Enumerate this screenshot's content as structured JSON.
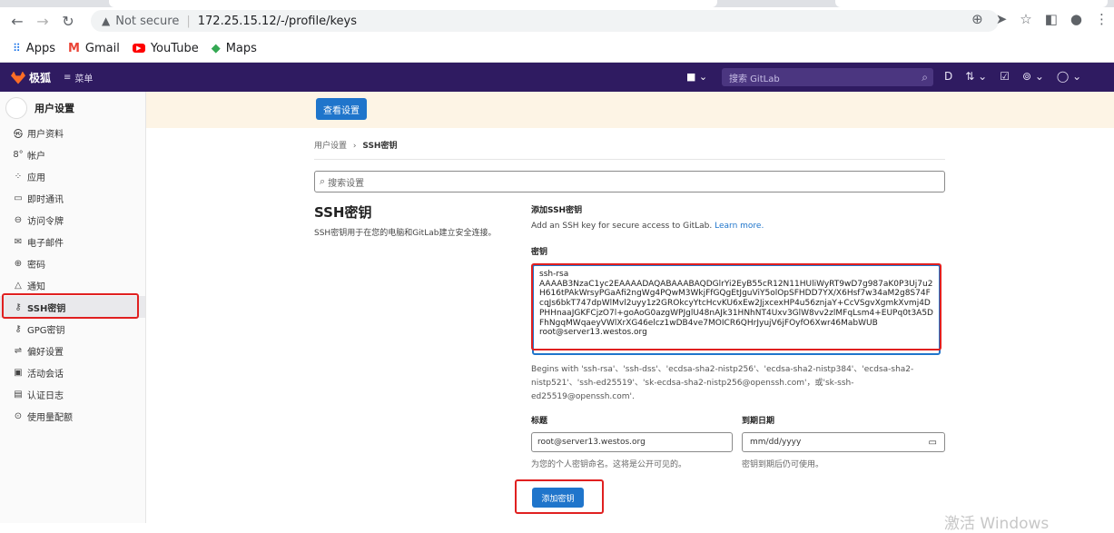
{
  "browser": {
    "warning_text": "Not secure",
    "url": "172.25.15.12/-/profile/keys",
    "bookmarks": [
      {
        "label": "Apps",
        "icon": "apps-grid-icon"
      },
      {
        "label": "Gmail",
        "icon": "gmail-icon"
      },
      {
        "label": "YouTube",
        "icon": "youtube-icon"
      },
      {
        "label": "Maps",
        "icon": "maps-icon"
      }
    ]
  },
  "gitlab_header": {
    "logo_text": "极狐",
    "menu_label": "菜单",
    "search_placeholder": "搜索 GitLab"
  },
  "sidebar": {
    "title": "用户设置",
    "items": [
      {
        "label": "用户资料",
        "icon": "profile-icon"
      },
      {
        "label": "帐户",
        "icon": "account-icon"
      },
      {
        "label": "应用",
        "icon": "applications-icon"
      },
      {
        "label": "即时通讯",
        "icon": "chat-icon"
      },
      {
        "label": "访问令牌",
        "icon": "token-icon"
      },
      {
        "label": "电子邮件",
        "icon": "email-icon"
      },
      {
        "label": "密码",
        "icon": "lock-icon"
      },
      {
        "label": "通知",
        "icon": "bell-icon"
      },
      {
        "label": "SSH密钥",
        "icon": "key-icon",
        "active": true
      },
      {
        "label": "GPG密钥",
        "icon": "key-icon"
      },
      {
        "label": "偏好设置",
        "icon": "preferences-icon"
      },
      {
        "label": "活动会话",
        "icon": "sessions-icon"
      },
      {
        "label": "认证日志",
        "icon": "log-icon"
      },
      {
        "label": "使用量配额",
        "icon": "quota-icon"
      }
    ]
  },
  "banner": {
    "button_label": "查看设置"
  },
  "breadcrumb": {
    "parent": "用户设置",
    "separator": "›",
    "current": "SSH密钥"
  },
  "search": {
    "placeholder": "搜索设置"
  },
  "left_panel": {
    "title": "SSH密钥",
    "description": "SSH密钥用于在您的电脑和GitLab建立安全连接。"
  },
  "form": {
    "section_title": "添加SSH密钥",
    "section_desc": "Add an SSH key for secure access to GitLab.",
    "learn_more": "Learn more.",
    "key_label": "密钥",
    "key_value": "ssh-rsa\nAAAAB3NzaC1yc2EAAAADAQABAAABAQDGlrYi2EyB55cR12N11HUliWyRT9wD7g987aK0P3Uj7u2H616tPAkWrsyPGaAfi2ngWg4PQwM3WkjFfGQgEtJguViY5olOpSFHDD7YX/X6Hsf7w34aM2g8S74FcqJs6bkT747dpWlMvl2uyy1z2GROkcyYtcHcvKU6xEw2JjxcexHP4u56znjaY+CcVSgvXgmkXvmj4DPHHnaaJGKFCjzO7l+goAoG0azgWPJglU48nAJk31HNhNT4Uxv3GlW8vv2zlMFqLsm4+EUPq0t3A5DFhNgqMWqaeyVWlXrXG46elcz1wDB4ve7MOICR6QHrJyujV6jFOyfO6Xwr46MabWUB\nroot@server13.westos.org",
    "key_hint": "Begins with 'ssh-rsa'、'ssh-dss'、'ecdsa-sha2-nistp256'、'ecdsa-sha2-nistp384'、'ecdsa-sha2-nistp521'、'ssh-ed25519'、'sk-ecdsa-sha2-nistp256@openssh.com'，或'sk-ssh-ed25519@openssh.com'.",
    "title_label": "标题",
    "title_value": "root@server13.westos.org",
    "title_help": "为您的个人密钥命名。这将是公开可见的。",
    "expiry_label": "到期日期",
    "expiry_placeholder": "mm/dd/yyyy",
    "expiry_help": "密钥到期后仍可使用。",
    "submit_label": "添加密钥"
  },
  "watermark": "激活 Windows"
}
